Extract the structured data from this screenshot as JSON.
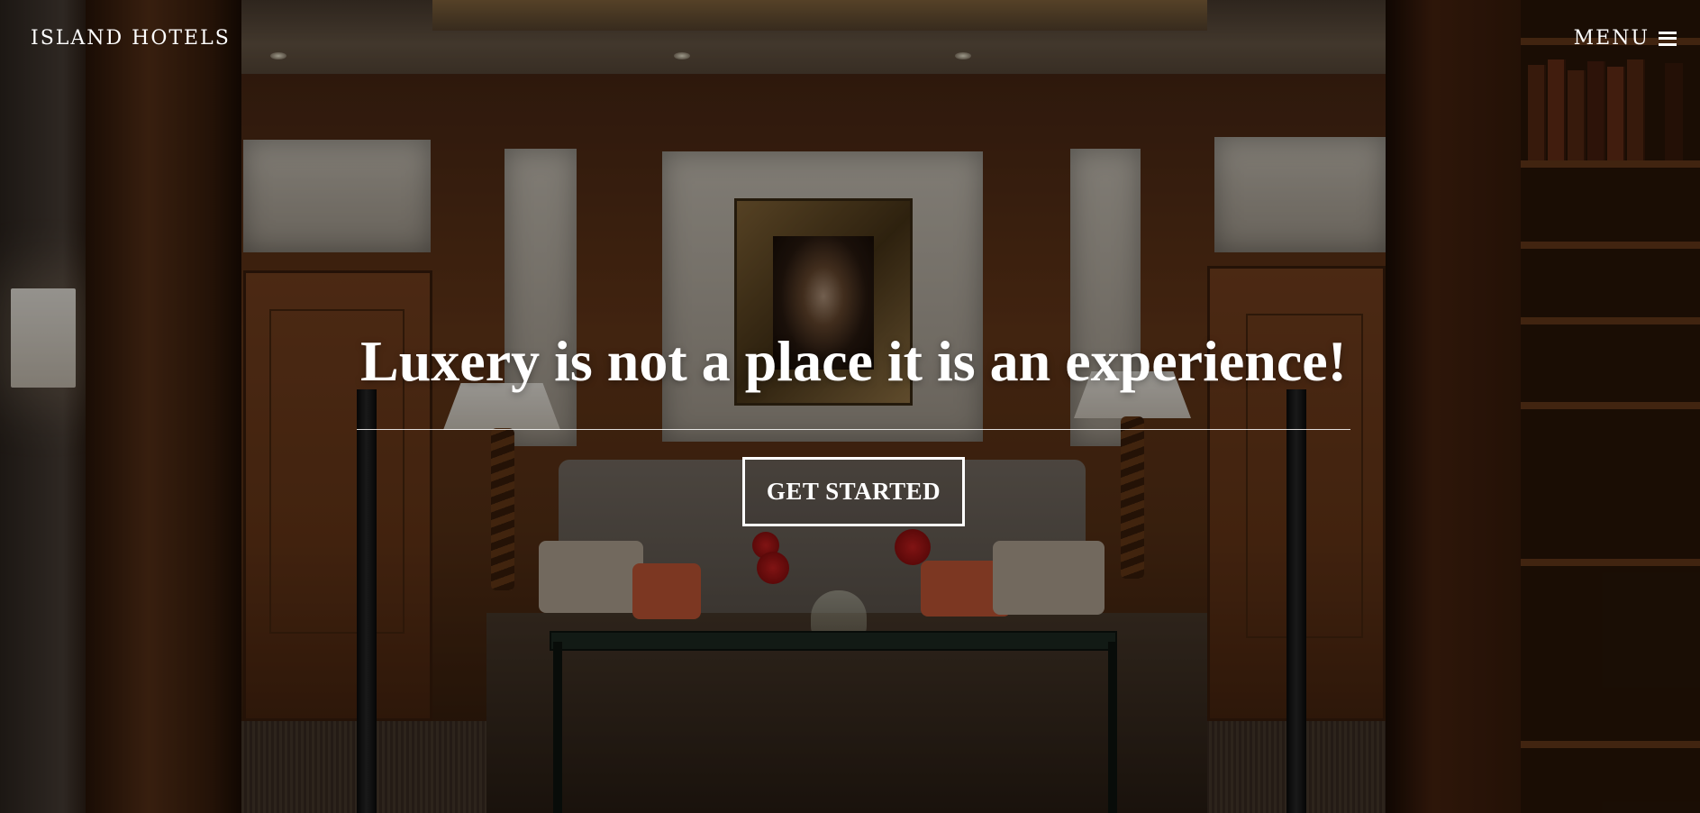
{
  "header": {
    "brand": "ISLAND HOTELS",
    "menu_label": "MENU",
    "menu_icon": "hamburger-icon"
  },
  "hero": {
    "headline": "Luxery is not a place it is an experience!",
    "cta_label": "GET STARTED",
    "background_image": "hotel-lobby-photo"
  },
  "colors": {
    "text": "#ffffff",
    "overlay": "rgba(0,0,0,0.38)"
  }
}
